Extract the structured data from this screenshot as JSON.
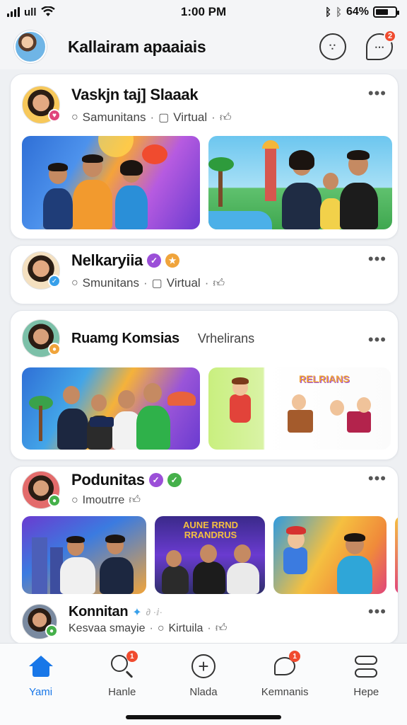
{
  "status": {
    "time": "1:00 PM",
    "battery": "64%",
    "battery_level": 0.64
  },
  "header": {
    "title": "Kallairam apaaiais",
    "notification_count": "2"
  },
  "posts": [
    {
      "name": "Vaskjn taj] Slaaak",
      "sub": [
        "Samunitans",
        "Virtual"
      ],
      "avatar_dot_color": "#e0457b"
    },
    {
      "name": "Nelkaryiia",
      "sub": [
        "Smunitans",
        "Virtual"
      ],
      "avatar_dot_color": "#38a0ea"
    },
    {
      "name": "Ruamg Komsias",
      "inline_text": "Vrhelirans",
      "avatar_dot_color": "#f0a43b",
      "thumb_caption": "RELRIANS"
    },
    {
      "name": "Podunitas",
      "sub": [
        "Imoutrre"
      ],
      "avatar_dot_color": "#45b04a",
      "thumb_caption": "AUNE RRND RRANDRUS"
    },
    {
      "name": "Konnitan",
      "sub": [
        "Kesvaa smayie",
        "Kirtuila"
      ],
      "avatar_dot_color": "#45b04a"
    }
  ],
  "tabs": [
    {
      "label": "Yami",
      "icon": "home-icon",
      "active": true
    },
    {
      "label": "Hanle",
      "icon": "search-icon",
      "badge": "1"
    },
    {
      "label": "Nlada",
      "icon": "add-icon"
    },
    {
      "label": "Kemnanis",
      "icon": "chat-icon",
      "badge": "1"
    },
    {
      "label": "Hepe",
      "icon": "menu-icon"
    }
  ],
  "colors": {
    "accent": "#1877e8",
    "badge": "#f04b2f"
  }
}
